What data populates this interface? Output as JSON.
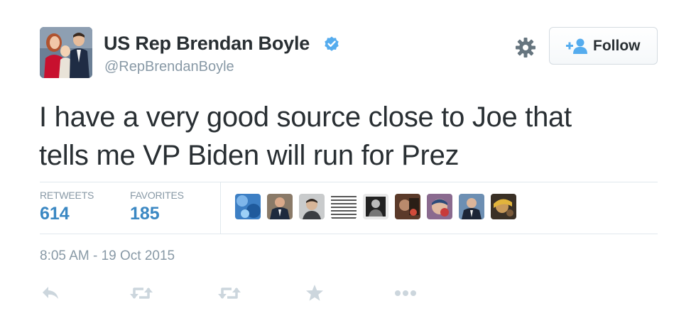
{
  "author": {
    "name": "US Rep Brendan Boyle",
    "handle": "@RepBrendanBoyle",
    "verified": true
  },
  "header": {
    "settings_icon": "gear-icon",
    "follow_button": {
      "label": "Follow",
      "icon": "add-user-icon"
    }
  },
  "tweet": {
    "text_line1": "I have a very good source close to Joe that",
    "text_line2": "tells me VP Biden will run for Prez",
    "timestamp": "8:05 AM - 19 Oct 2015"
  },
  "stats": {
    "retweets_label": "RETWEETS",
    "retweets_value": "614",
    "favorites_label": "FAVORITES",
    "favorites_value": "185"
  },
  "actions": [
    {
      "name": "reply",
      "icon": "reply-icon"
    },
    {
      "name": "retweet",
      "icon": "retweet-icon"
    },
    {
      "name": "retweet-alt",
      "icon": "retweet-icon"
    },
    {
      "name": "favorite",
      "icon": "star-icon"
    },
    {
      "name": "more",
      "icon": "more-icon"
    }
  ],
  "colors": {
    "text": "#292f33",
    "muted": "#8899a6",
    "link": "#3b88c3",
    "verified": "#55acee",
    "divider": "#e1e8ed"
  }
}
